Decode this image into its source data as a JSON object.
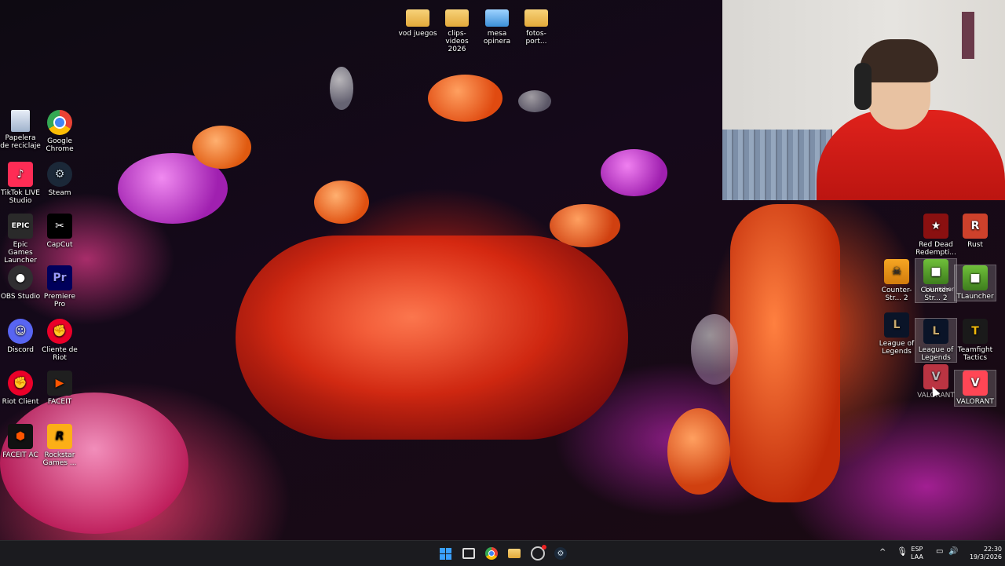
{
  "desktop": {
    "top_folders": [
      {
        "label": "vod juegos"
      },
      {
        "label": "clips-videos 2026"
      },
      {
        "label": "mesa opinera"
      },
      {
        "label": "fotos-port..."
      }
    ],
    "left_icons": [
      {
        "label": "Papelera de reciclaje",
        "icon": "recycle-bin-icon"
      },
      {
        "label": "Google Chrome",
        "icon": "chrome-icon"
      },
      {
        "label": "TikTok LIVE Studio",
        "icon": "tiktok-icon"
      },
      {
        "label": "Steam",
        "icon": "steam-icon"
      },
      {
        "label": "Epic Games Launcher",
        "icon": "epic-games-icon"
      },
      {
        "label": "CapCut",
        "icon": "capcut-icon"
      },
      {
        "label": "OBS Studio",
        "icon": "obs-icon"
      },
      {
        "label": "Premiere Pro",
        "icon": "premiere-icon"
      },
      {
        "label": "Discord",
        "icon": "discord-icon"
      },
      {
        "label": "Cliente de Riot",
        "icon": "riot-icon"
      },
      {
        "label": "Riot Client",
        "icon": "riot-client-icon"
      },
      {
        "label": "FACEIT",
        "icon": "faceit-icon"
      },
      {
        "label": "FACEIT AC",
        "icon": "faceit-ac-icon"
      },
      {
        "label": "Rockstar Games ...",
        "icon": "rockstar-icon"
      }
    ],
    "right_icons": [
      {
        "label": "Red Dead Redempti...",
        "icon": "rdr-icon"
      },
      {
        "label": "Rust",
        "icon": "rust-icon"
      },
      {
        "label": "Counter-Str... 2",
        "icon": "cs2-icon"
      },
      {
        "label": "Counter-Str... 2",
        "icon": "cs2-icon-2"
      },
      {
        "label": "TLauncher",
        "icon": "tlauncher-icon"
      },
      {
        "label": "League of Legends",
        "icon": "lol-icon"
      },
      {
        "label": "League of Legends",
        "icon": "lol-icon-2"
      },
      {
        "label": "Teamfight Tactics",
        "icon": "tft-icon"
      },
      {
        "label": "VALORANT",
        "icon": "valorant-icon"
      },
      {
        "label": "VALORANT",
        "icon": "valorant-icon-2"
      }
    ],
    "drag_ghost_label": "Launcher",
    "glyphs": {
      "premiere": "Pr",
      "epic": "EPIC",
      "rockstar": "R",
      "tft": "T",
      "rust": "R",
      "steam": "⚙"
    }
  },
  "taskbar": {
    "language": "ESP",
    "language_sub": "LAA",
    "time": "22:30",
    "date": "19/3/2026",
    "chevron": "^"
  },
  "colors": {
    "taskbar": "#1b1b1f",
    "folder": "#e3a93a",
    "valorant": "#ff4655"
  }
}
